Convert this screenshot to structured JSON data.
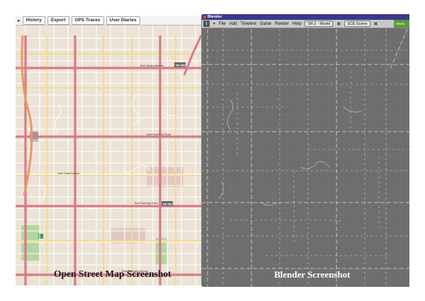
{
  "osm": {
    "tabs": [
      "History",
      "Export",
      "GPS Traces",
      "User Diaries"
    ],
    "caption": "Open Street Map Screenshot",
    "road_labels": [
      "East Sahara Avenue",
      "East Desert Inn Road",
      "East Twain Avenue",
      "East Flamingo Road",
      "East Tropicana Avenue"
    ],
    "shields": [
      "SR 589",
      "SR 592"
    ],
    "colors": {
      "land": "#ece3d6",
      "arterial": "#d9798a",
      "collector": "#f2dc8e",
      "minor": "#ffffff",
      "park": "#b5d6a0"
    }
  },
  "blender": {
    "title": "Blender",
    "menu": [
      "File",
      "Add",
      "Timeline",
      "Game",
      "Render",
      "Help"
    ],
    "screen_field": "SR:2 - Model",
    "scene_field": "SCE:Scene",
    "www_label": "www.",
    "caption": "Blender Screenshot",
    "colors": {
      "background": "#6e6e6e",
      "edges": "#d8d8d8"
    }
  }
}
